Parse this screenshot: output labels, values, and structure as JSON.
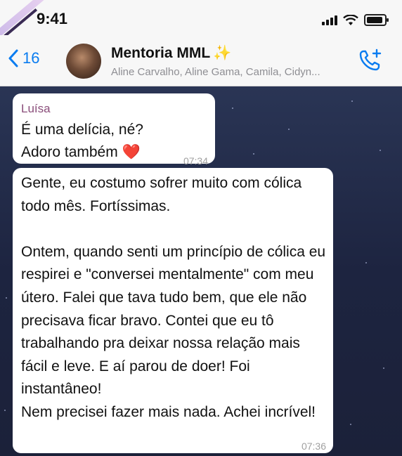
{
  "status_bar": {
    "time": "9:41"
  },
  "header": {
    "back_count": "16",
    "title": "Mentoria MML",
    "title_emoji": "✨",
    "members": "Aline Carvalho, Aline Gama, Camila, Cidyn..."
  },
  "messages": [
    {
      "sender": "Luísa",
      "lines": [
        "É uma delícia, né?",
        "Adoro também"
      ],
      "emoji": "❤️",
      "time": "07:34"
    },
    {
      "text": "Gente, eu costumo sofrer muito com cólica todo mês. Fortíssimas.\n\nOntem, quando senti um princípio de cólica eu respirei e \"conversei mentalmente\" com meu útero. Falei que tava tudo bem, que ele não precisava ficar bravo. Contei que eu tô trabalhando pra deixar nossa relação mais fácil e leve.  E aí parou de doer! Foi instantâneo!\nNem precisei fazer mais nada. Achei incrível!",
      "time": "07:36"
    }
  ],
  "colors": {
    "accent": "#0a7cf0",
    "sender_name": "#8a4d7a",
    "chat_bg": "#1d2440"
  }
}
